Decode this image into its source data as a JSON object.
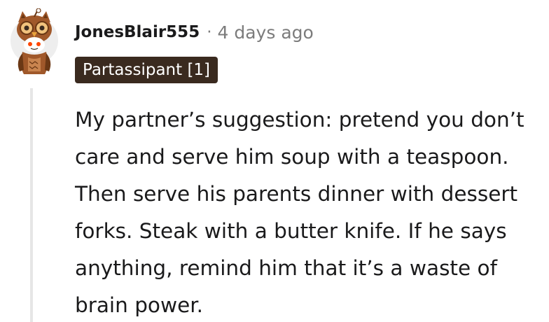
{
  "comment": {
    "username": "JonesBlair555",
    "separator": "·",
    "timestamp": "4 days ago",
    "flair": "Partassipant [1]",
    "body": "My partner’s suggestion: pretend you don’t care and serve him soup with a teaspoon. Then serve his parents dinner with dessert forks. Steak with a butter knife. If he says anything, remind him that it’s a waste of brain power."
  },
  "avatar": {
    "icon": "snoo-owl-costume-avatar",
    "colors": {
      "costume": "#a0582a",
      "costume_dark": "#6b3815",
      "face": "#ffffff",
      "eyes": "#ff4500",
      "background": "#eeeeee"
    }
  },
  "colors": {
    "flair_background": "#3a2a1f",
    "meta_text": "#7c7c7c",
    "thread_line": "#e6e6e6"
  }
}
